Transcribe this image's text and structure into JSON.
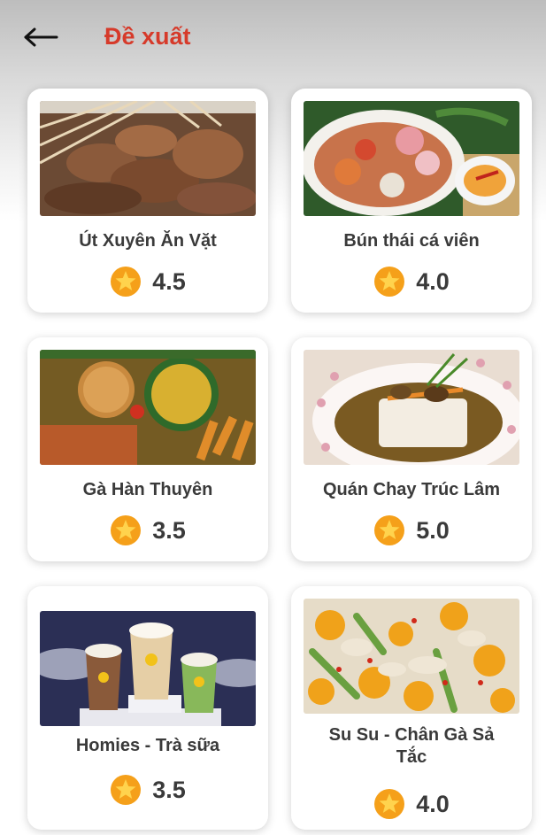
{
  "header": {
    "title": "Đề xuất",
    "back_icon": "arrow-left-icon"
  },
  "colors": {
    "title": "#d63a2a",
    "star_fill": "#f5a01a",
    "star_inner": "#ffd34d",
    "text": "#3a3a3a"
  },
  "restaurants": [
    {
      "name": "Út Xuyên Ăn Vặt",
      "rating": "4.5",
      "image": "grilled-skewers-photo"
    },
    {
      "name": "Bún thái cá viên",
      "rating": "4.0",
      "image": "thai-noodle-fishball-photo"
    },
    {
      "name": "Gà Hàn Thuyên",
      "rating": "3.5",
      "image": "chicken-platter-photo"
    },
    {
      "name": "Quán Chay Trúc Lâm",
      "rating": "5.0",
      "image": "vegetarian-tofu-photo"
    },
    {
      "name": "Homies - Trà sữa",
      "rating": "3.5",
      "image": "milk-tea-cups-photo"
    },
    {
      "name": "Su Su - Chân Gà Sả Tắc",
      "rating": "4.0",
      "image": "chicken-feet-kumquat-photo"
    }
  ]
}
